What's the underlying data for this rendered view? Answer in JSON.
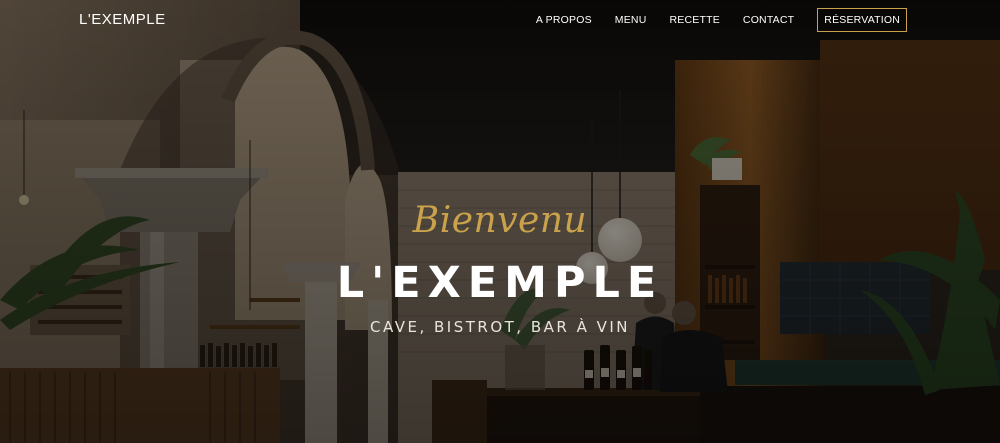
{
  "brand": {
    "name": "L'EXEMPLE"
  },
  "nav": {
    "items": [
      {
        "label": "A PROPOS"
      },
      {
        "label": "MENU"
      },
      {
        "label": "RECETTE"
      },
      {
        "label": "CONTACT"
      }
    ],
    "cta_label": "RÉSERVATION"
  },
  "hero": {
    "welcome": "Bienvenu",
    "title": "L'EXEMPLE",
    "subtitle": "CAVE, BISTROT, BAR À VIN"
  },
  "colors": {
    "accent": "#c9a24b",
    "overlay": "#0d0b09"
  }
}
